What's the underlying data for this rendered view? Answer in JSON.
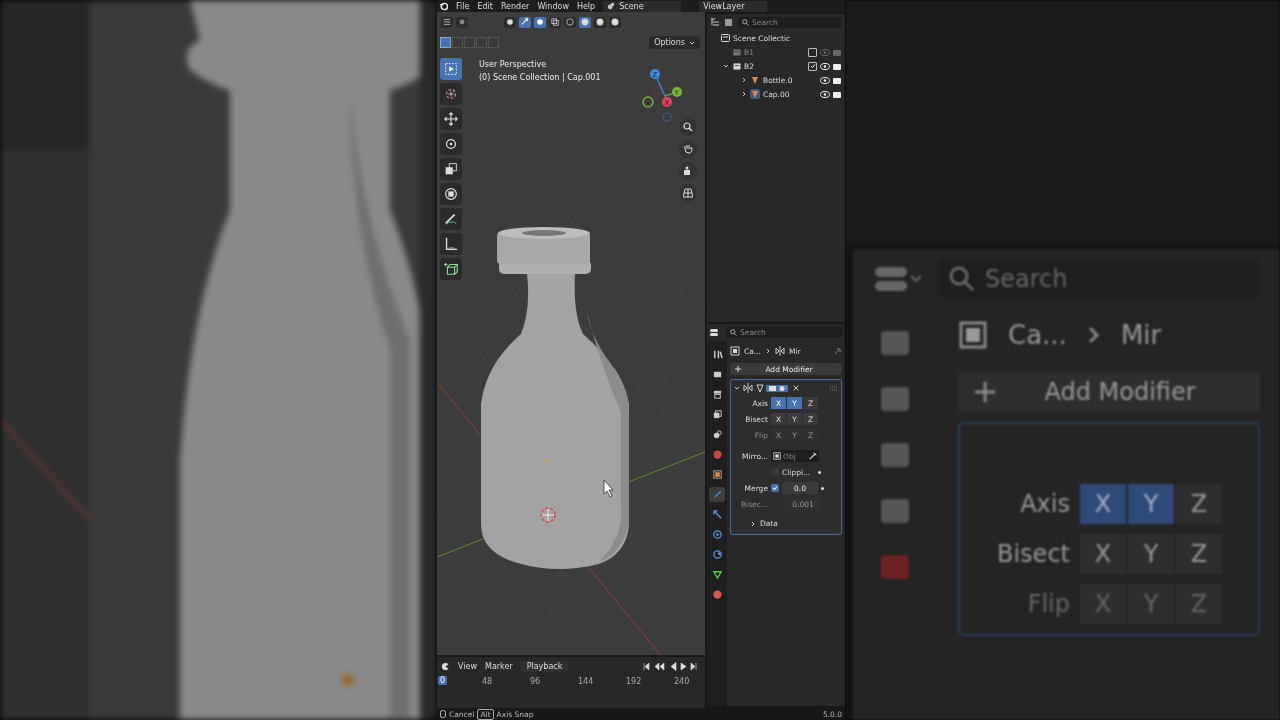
{
  "menu_bar": {
    "items": [
      "File",
      "Edit",
      "Render",
      "Window",
      "Help"
    ],
    "scene": "Scene",
    "view_layer": "ViewLayer"
  },
  "viewport": {
    "select_modes": [
      {
        "selected": true
      },
      {
        "selected": false
      },
      {
        "selected": false
      },
      {
        "selected": false
      },
      {
        "selected": false
      }
    ],
    "shading_modes": [
      {
        "selected": false
      },
      {
        "selected": true
      },
      {
        "selected": false
      },
      {
        "selected": false
      }
    ],
    "options": "Options",
    "overlay_lines": [
      "User Perspective",
      "(0) Scene Collection | Cap.001"
    ],
    "gizmo_axes": [
      "X",
      "Y",
      "Z"
    ],
    "tools": [
      {
        "kind": "select",
        "selected": true
      },
      {
        "kind": "cursor",
        "selected": false
      },
      {
        "kind": "move",
        "selected": false
      },
      {
        "kind": "rotate",
        "selected": false
      },
      {
        "kind": "scale",
        "selected": false
      },
      {
        "kind": "transform",
        "selected": false
      },
      {
        "kind": "annotate",
        "selected": false
      },
      {
        "kind": "measure",
        "selected": false
      },
      {
        "kind": "add_cube",
        "selected": false
      }
    ]
  },
  "outliner": {
    "search_placeholder": "Search",
    "root": "Scene Collectic",
    "items": [
      {
        "name": "B1",
        "kind": "collection",
        "disabled": true,
        "checked": false,
        "expanded": false
      },
      {
        "name": "B2",
        "kind": "collection",
        "disabled": false,
        "checked": true,
        "expanded": true,
        "children": [
          {
            "name": "Bottle.0",
            "kind": "mesh",
            "selected": false
          },
          {
            "name": "Cap.00",
            "kind": "mesh",
            "selected": true
          }
        ]
      }
    ]
  },
  "properties": {
    "search_placeholder": "Search",
    "tabs": [
      {
        "kind": "tool",
        "selected": false
      },
      {
        "kind": "render",
        "selected": false
      },
      {
        "kind": "output",
        "selected": false
      },
      {
        "kind": "view_layer",
        "selected": false
      },
      {
        "kind": "scene",
        "selected": false
      },
      {
        "kind": "world",
        "selected": false
      },
      {
        "kind": "object",
        "selected": false
      },
      {
        "kind": "modifier",
        "selected": true
      },
      {
        "kind": "particles",
        "selected": false
      },
      {
        "kind": "physics",
        "selected": false
      },
      {
        "kind": "constraints",
        "selected": false
      },
      {
        "kind": "data",
        "selected": false
      },
      {
        "kind": "material",
        "selected": false
      }
    ],
    "breadcrumb": [
      "Ca...",
      "Mir"
    ],
    "add_modifier": "Add Modifier",
    "modifier": {
      "expanded": true,
      "axis_rows": [
        {
          "label": "Axis",
          "disabled": false,
          "buttons": [
            {
              "label": "X",
              "selected": true
            },
            {
              "label": "Y",
              "selected": true
            },
            {
              "label": "Z",
              "selected": false
            }
          ]
        },
        {
          "label": "Bisect",
          "disabled": false,
          "buttons": [
            {
              "label": "X",
              "selected": false
            },
            {
              "label": "Y",
              "selected": false
            },
            {
              "label": "Z",
              "selected": false
            }
          ]
        },
        {
          "label": "Flip",
          "disabled": true,
          "buttons": [
            {
              "label": "X",
              "selected": false
            },
            {
              "label": "Y",
              "selected": false
            },
            {
              "label": "Z",
              "selected": false
            }
          ]
        }
      ],
      "mirror_label": "Mirro...",
      "mirror_placeholder": "Obj",
      "clipping": {
        "label": "Clippi...",
        "checked": false
      },
      "merge": {
        "label": "Merge",
        "checked": true,
        "value": "0.0"
      },
      "bisect_distance": {
        "label": "Bisec...",
        "value": "0.001",
        "disabled": true
      },
      "data_panel": {
        "label": "Data",
        "expanded": false
      }
    }
  },
  "timeline": {
    "menus": [
      "View",
      "Marker",
      "Playback"
    ],
    "frame_ticks": [
      "0",
      "48",
      "96",
      "144",
      "192",
      "240"
    ]
  },
  "status_bar": {
    "cancel": "Cancel",
    "key": "Alt",
    "hint": "Axis Snap",
    "version": "5.0.0"
  },
  "backdrop": {
    "search_placeholder": "Search",
    "breadcrumb": [
      "Ca...",
      "Mir"
    ],
    "add_modifier": "Add Modifier",
    "rows": [
      {
        "label": "Axis",
        "disabled": false,
        "buttons": [
          {
            "label": "X",
            "selected": true
          },
          {
            "label": "Y",
            "selected": true
          },
          {
            "label": "Z",
            "selected": false
          }
        ]
      },
      {
        "label": "Bisect",
        "disabled": false,
        "buttons": [
          {
            "label": "X",
            "selected": false
          },
          {
            "label": "Y",
            "selected": false
          },
          {
            "label": "Z",
            "selected": false
          }
        ]
      },
      {
        "label": "Flip",
        "disabled": true,
        "buttons": [
          {
            "label": "X",
            "selected": false
          },
          {
            "label": "Y",
            "selected": false
          },
          {
            "label": "Z",
            "selected": false
          }
        ]
      }
    ]
  }
}
